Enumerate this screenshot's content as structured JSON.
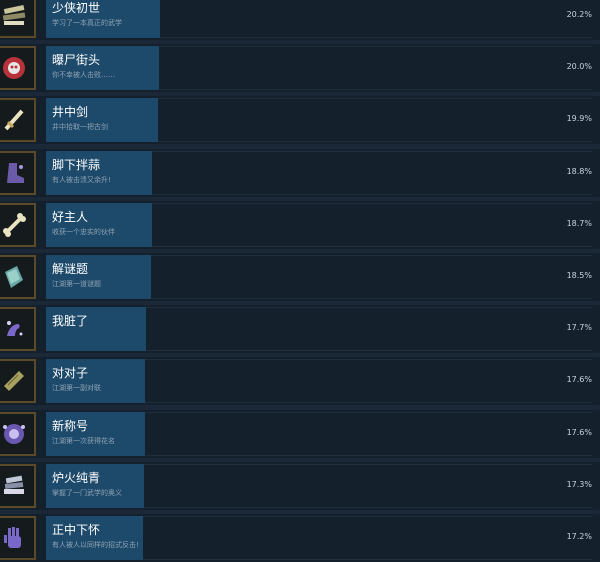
{
  "achievements": [
    {
      "title": "少侠初世",
      "desc": "学习了一本真正的武学",
      "percent": "20.2%",
      "fraction": 0.202,
      "icon": "scroll-stack-icon"
    },
    {
      "title": "曝尸街头",
      "desc": "你不幸被人击败……",
      "percent": "20.0%",
      "fraction": 0.2,
      "icon": "demon-mask-icon"
    },
    {
      "title": "井中剑",
      "desc": "井中拾取一把古剑",
      "percent": "19.9%",
      "fraction": 0.199,
      "icon": "sword-icon"
    },
    {
      "title": "脚下拌蒜",
      "desc": "有人被击溃又余升!",
      "percent": "18.8%",
      "fraction": 0.188,
      "icon": "boot-icon"
    },
    {
      "title": "好主人",
      "desc": "收获一个忠实的伙伴",
      "percent": "18.7%",
      "fraction": 0.187,
      "icon": "bone-icon"
    },
    {
      "title": "解谜题",
      "desc": "江湖第一道谜题",
      "percent": "18.5%",
      "fraction": 0.185,
      "icon": "book-icon"
    },
    {
      "title": "我脏了",
      "desc": "",
      "percent": "17.7%",
      "fraction": 0.177,
      "icon": "hand-sparkle-icon"
    },
    {
      "title": "对对子",
      "desc": "江湖第一副对联",
      "percent": "17.6%",
      "fraction": 0.176,
      "icon": "couplet-scroll-icon"
    },
    {
      "title": "新称号",
      "desc": "江湖第一次获得花名",
      "percent": "17.6%",
      "fraction": 0.176,
      "icon": "emblem-icon"
    },
    {
      "title": "炉火纯青",
      "desc": "掌握了一门武学的奥义",
      "percent": "17.3%",
      "fraction": 0.173,
      "icon": "books-icon"
    },
    {
      "title": "正中下怀",
      "desc": "有人被人以同样的招式反击!",
      "percent": "17.2%",
      "fraction": 0.172,
      "icon": "open-palm-icon"
    }
  ]
}
